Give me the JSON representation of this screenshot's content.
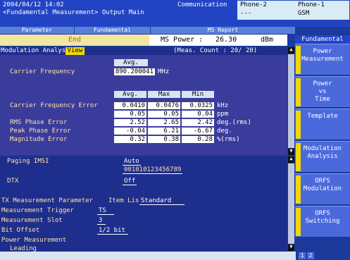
{
  "topbar": {
    "date": "2004/04/12 14:02",
    "subtitle": "<Fundamental Measurement> Output Main",
    "communication": "Communication",
    "phone2": {
      "name": "Phone-2",
      "value": "---"
    },
    "phone1": {
      "name": "Phone-1",
      "value": "GSM"
    }
  },
  "tabs": [
    "Parameter",
    "Fundamental",
    "MS Report"
  ],
  "status": {
    "end": "End",
    "ms_power_label": "MS Power :",
    "ms_power_value": "26.30",
    "ms_power_unit": "dBm"
  },
  "modulation": {
    "title": "Modulation Analysis",
    "view": "View",
    "meas_count": "(Meas. Count :    20/   20)",
    "avg_header": "Avg.",
    "carrier_frequency_label": "Carrier Frequency",
    "carrier_frequency_value": "890.200041",
    "carrier_frequency_unit": "MHz",
    "col_headers": [
      "Avg.",
      "Max",
      "Min"
    ],
    "rows": [
      {
        "label": "Carrier Frequency Error",
        "values": [
          "0.0410",
          "0.0476",
          "0.0325"
        ],
        "unit": "kHz"
      },
      {
        "label": "",
        "values": [
          "0.05",
          "0.05",
          "0.04"
        ],
        "unit": "ppm"
      },
      {
        "label": "RMS Phase Error",
        "values": [
          "2.52",
          "2.65",
          "2.42"
        ],
        "unit": "deg.(rms)"
      },
      {
        "label": "Peak Phase Error",
        "values": [
          "-0.04",
          "6.21",
          "-6.67"
        ],
        "unit": "deg."
      },
      {
        "label": "Magnitude Error",
        "values": [
          "0.32",
          "0.38",
          "0.28"
        ],
        "unit": "%(rms)"
      }
    ]
  },
  "lower": {
    "paging_imsi_label": "Paging IMSI",
    "paging_imsi_mode": "Auto",
    "paging_imsi_value": "001010123456789",
    "dtx_label": "DTX",
    "dtx_value": "Off",
    "tx_param_label": "TX Measurement Parameter",
    "item_list_label": "Item List",
    "item_list_value": "Standard",
    "trigger_label": "Measurement Trigger",
    "trigger_value": "TS",
    "slot_label": "Measurement Slot",
    "slot_value": "3",
    "bit_offset_label": "Bit Offset",
    "bit_offset_value": "1/2 bit",
    "power_meas_label": "Power Measurement",
    "leading_label": "Leading"
  },
  "side": {
    "header": "Fundamental",
    "buttons": [
      {
        "lines": [
          "Power",
          "Measurement"
        ]
      },
      {
        "lines": [
          "Power",
          "vs",
          "Time"
        ]
      },
      {
        "lines": [
          "Template"
        ]
      },
      {
        "lines": [
          "Modulation",
          "Analysis"
        ]
      },
      {
        "lines": [
          "ORFS",
          "Modulation"
        ]
      },
      {
        "lines": [
          "ORFS",
          "Switching"
        ]
      }
    ],
    "page": "1",
    "page2": "2"
  },
  "colors": {
    "panel": "#3a3c9c",
    "accent": "#f0d800",
    "label": "#ffe1a8"
  }
}
